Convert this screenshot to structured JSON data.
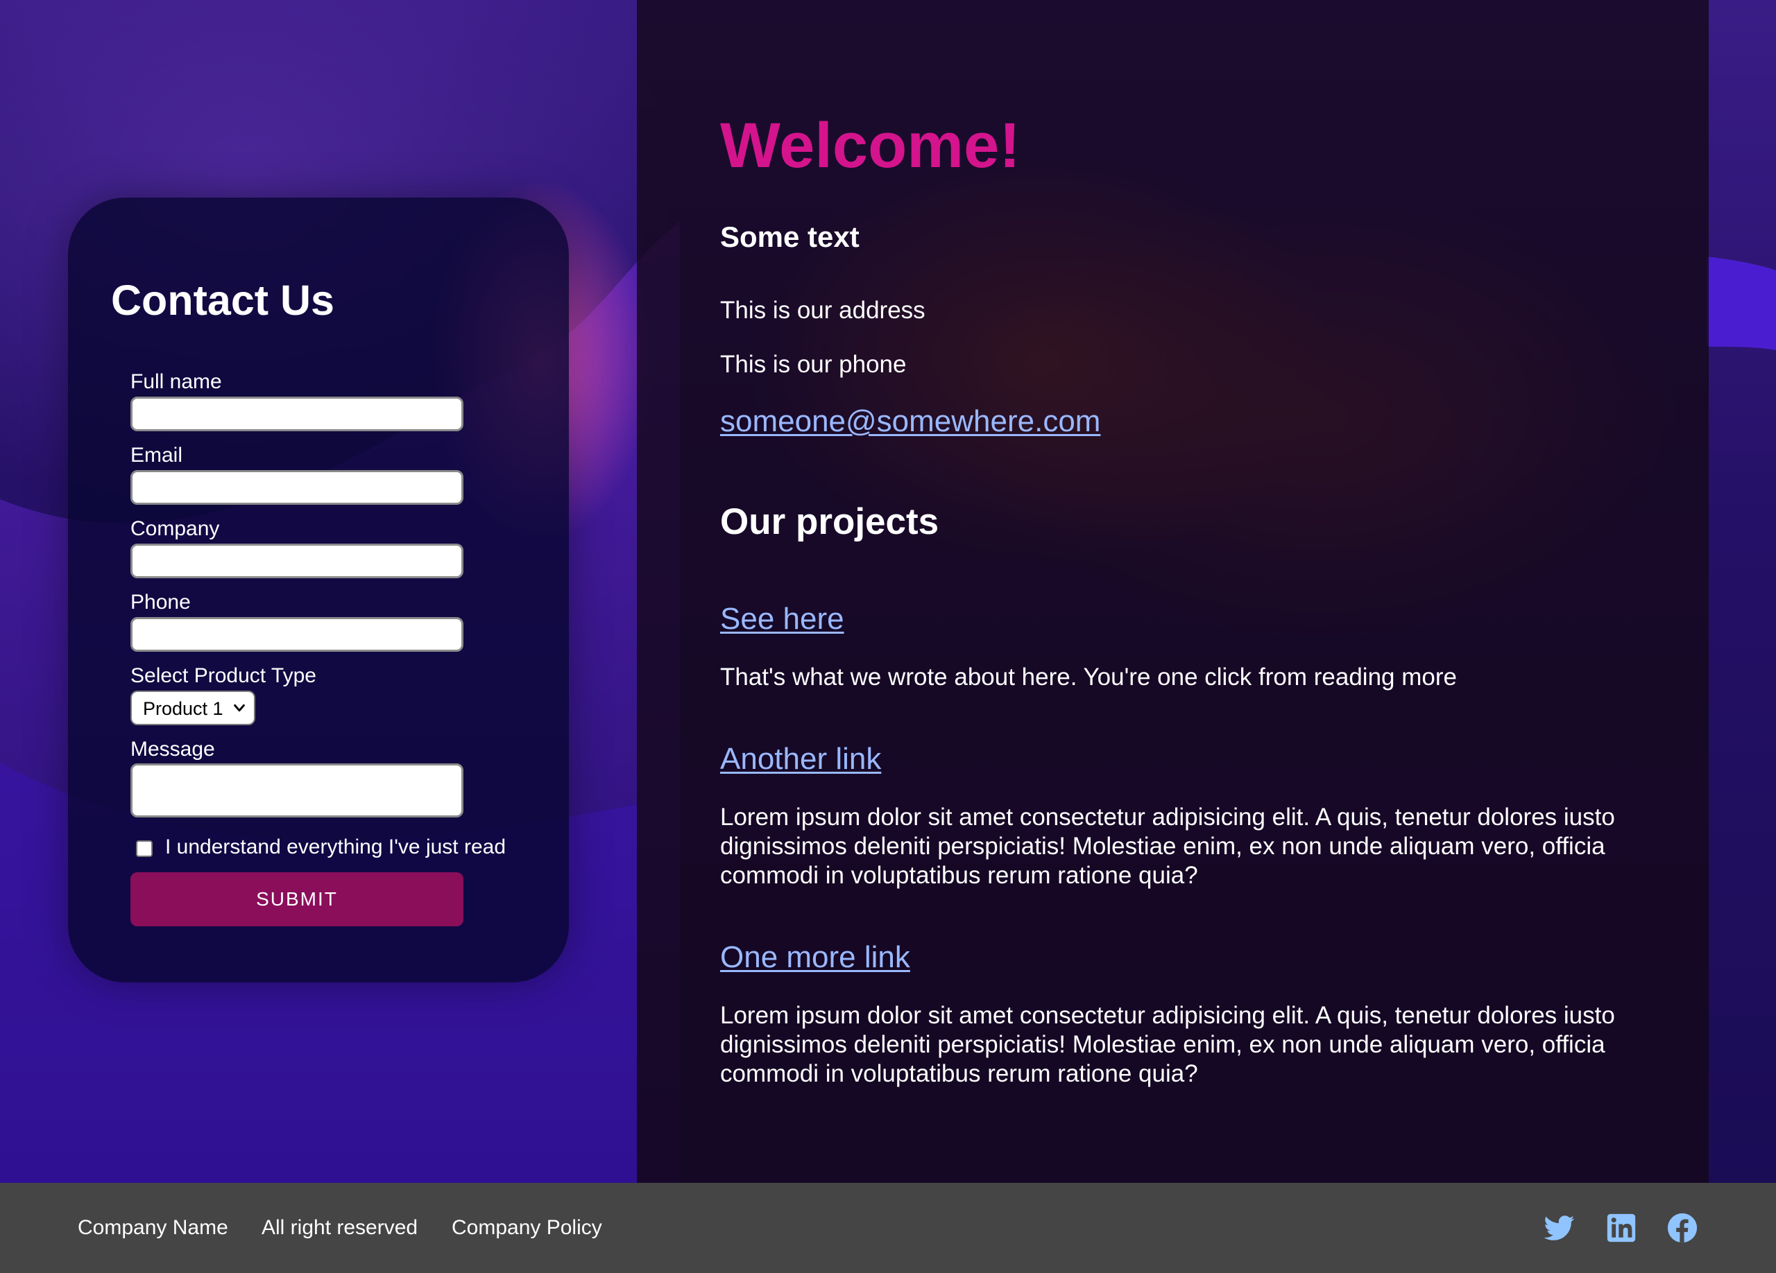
{
  "contact": {
    "title": "Contact Us",
    "full_name_label": "Full name",
    "email_label": "Email",
    "company_label": "Company",
    "phone_label": "Phone",
    "product_type_label": "Select Product Type",
    "product_selected": "Product 1",
    "message_label": "Message",
    "checkbox_label": "I understand everything I've just read",
    "checkbox_checked": false,
    "submit_label": "SUBMIT"
  },
  "main": {
    "welcome": "Welcome!",
    "subheading": "Some text",
    "address": "This is our address",
    "phone": "This is our phone",
    "email_link": "someone@somewhere.com",
    "projects_heading": "Our projects",
    "projects": [
      {
        "link": "See here",
        "text": "That's what we wrote about here. You're one click from reading more"
      },
      {
        "link": "Another link",
        "text": "Lorem ipsum dolor sit amet consectetur adipisicing elit. A quis, tenetur dolores iusto dignissimos deleniti perspiciatis! Molestiae enim, ex non unde aliquam vero, officia commodi in voluptatibus rerum ratione quia?"
      },
      {
        "link": "One more link",
        "text": "Lorem ipsum dolor sit amet consectetur adipisicing elit. A quis, tenetur dolores iusto dignissimos deleniti perspiciatis! Molestiae enim, ex non unde aliquam vero, officia commodi in voluptatibus rerum ratione quia?"
      }
    ]
  },
  "footer": {
    "company_name": "Company Name",
    "rights": "All right reserved",
    "policy": "Company Policy",
    "social_icons": [
      "twitter-icon",
      "linkedin-icon",
      "facebook-icon"
    ]
  },
  "colors": {
    "accent": "#d4148c",
    "submit_button": "#8b0e5a",
    "link": "#9ab8ff",
    "footer_bg": "#454545"
  }
}
